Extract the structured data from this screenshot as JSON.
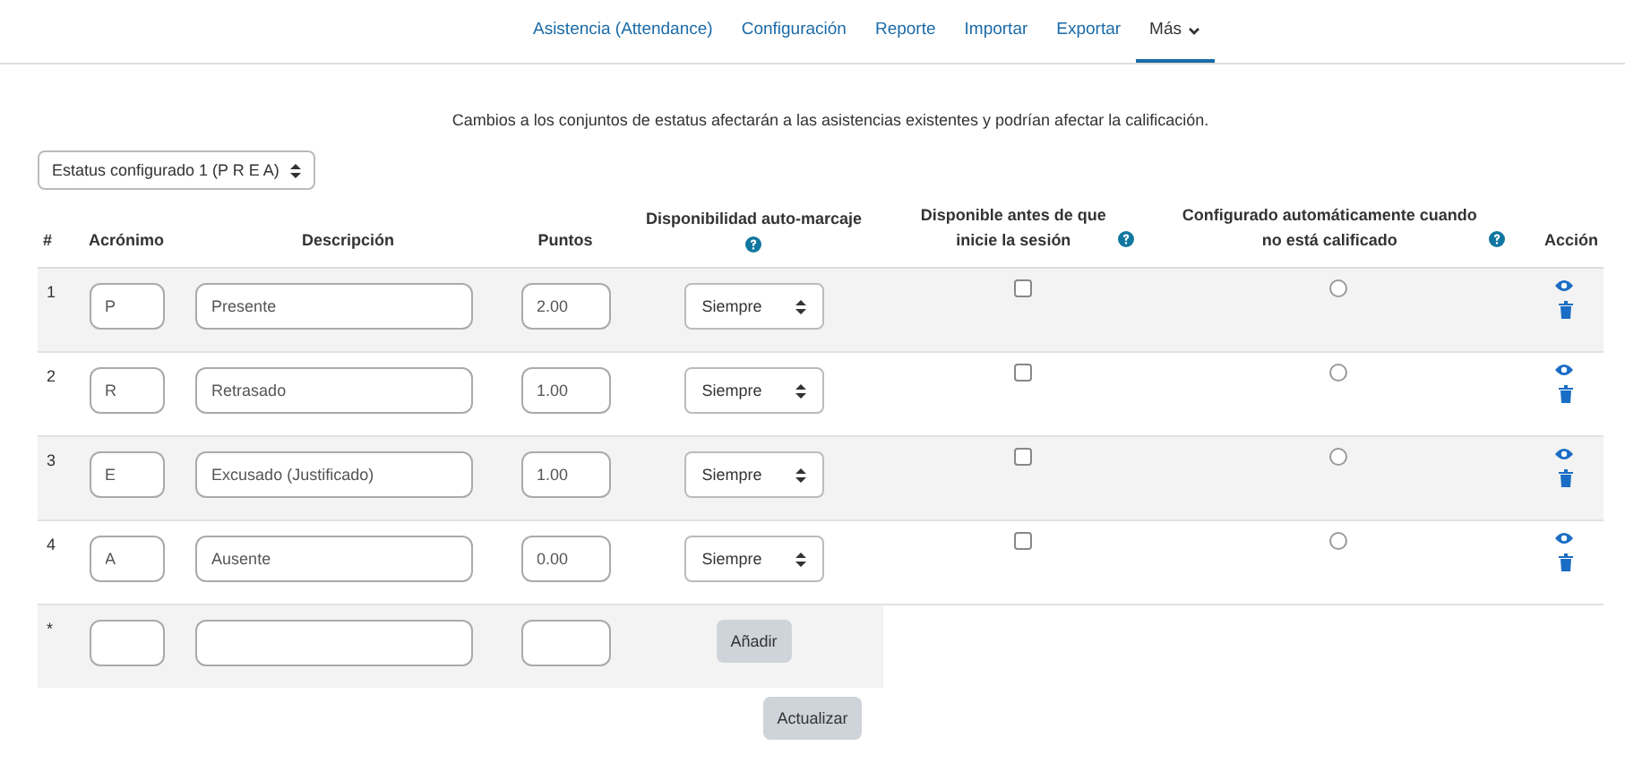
{
  "nav": {
    "tabs": [
      {
        "label": "Asistencia (Attendance)",
        "selected": false,
        "dropdown": false
      },
      {
        "label": "Configuración",
        "selected": false,
        "dropdown": false
      },
      {
        "label": "Reporte",
        "selected": false,
        "dropdown": false
      },
      {
        "label": "Importar",
        "selected": false,
        "dropdown": false
      },
      {
        "label": "Exportar",
        "selected": false,
        "dropdown": false
      },
      {
        "label": "Más",
        "selected": true,
        "dropdown": true
      }
    ]
  },
  "notice": "Cambios a los conjuntos de estatus afectarán a las asistencias existentes y podrían afectar la calificación.",
  "status_set_select": {
    "value": "Estatus configurado 1 (P R E A)"
  },
  "table": {
    "columns": [
      {
        "label": "#",
        "help": false
      },
      {
        "label": "Acrónimo",
        "help": false
      },
      {
        "label": "Descripción",
        "help": false
      },
      {
        "label": "Puntos",
        "help": false
      },
      {
        "label": "Disponibilidad auto-marcaje",
        "help": true
      },
      {
        "label": "Disponible antes de que inicie la sesión",
        "help": true
      },
      {
        "label": "Configurado automáticamente cuando no está calificado",
        "help": true
      },
      {
        "label": "Acción",
        "help": false
      }
    ],
    "rows": [
      {
        "number": "1",
        "acronym": "P",
        "description": "Presente",
        "points": "2.00",
        "availability": "Siempre",
        "before_session": false,
        "auto_set": false
      },
      {
        "number": "2",
        "acronym": "R",
        "description": "Retrasado",
        "points": "1.00",
        "availability": "Siempre",
        "before_session": false,
        "auto_set": false
      },
      {
        "number": "3",
        "acronym": "E",
        "description": "Excusado (Justificado)",
        "points": "1.00",
        "availability": "Siempre",
        "before_session": false,
        "auto_set": false
      },
      {
        "number": "4",
        "acronym": "A",
        "description": "Ausente",
        "points": "0.00",
        "availability": "Siempre",
        "before_session": false,
        "auto_set": false
      }
    ],
    "new_row": {
      "marker": "*",
      "add_button": "Añadir"
    }
  },
  "update_button": "Actualizar"
}
